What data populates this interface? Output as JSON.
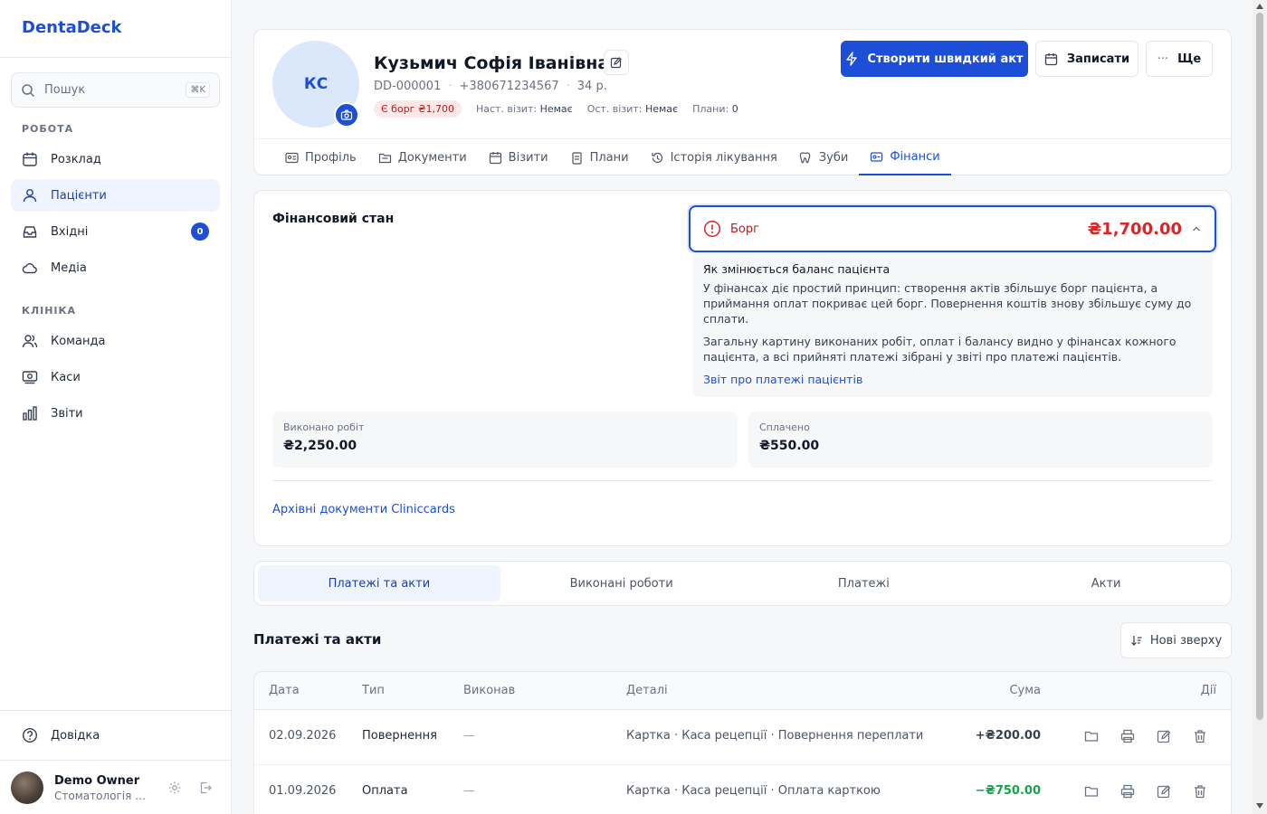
{
  "app": {
    "brand": "DentaDeck"
  },
  "search": {
    "placeholder": "Пошук",
    "shortcut": "⌘K"
  },
  "sidebar": {
    "section_work": "РОБОТА",
    "section_clinic": "КЛІНІКА",
    "items": [
      {
        "label": "Розклад",
        "icon": "calendar-icon"
      },
      {
        "label": "Пацієнти",
        "icon": "users-icon",
        "active": true
      },
      {
        "label": "Вхідні",
        "icon": "inbox-icon",
        "badge": "0"
      },
      {
        "label": "Медіа",
        "icon": "cloud-icon"
      },
      {
        "label": "Команда",
        "icon": "team-icon"
      },
      {
        "label": "Каси",
        "icon": "cash-register-icon"
      },
      {
        "label": "Звіти",
        "icon": "bar-chart-icon"
      }
    ],
    "help": "Довідка",
    "user": {
      "name": "Demo Owner",
      "org": "Стоматологія П..."
    }
  },
  "patient": {
    "initials": "КС",
    "name": "Кузьмич Софія Іванівна",
    "id": "DD-000001",
    "phone": "+380671234567",
    "age": "34 р.",
    "debt_pill": "Є борг ₴1,700",
    "next_visit_label": "Наст. візит:",
    "next_visit_value": "Немає",
    "last_visit_label": "Ост. візит:",
    "last_visit_value": "Немає",
    "plans_label": "Плани:",
    "plans_value": "0"
  },
  "actions": {
    "quick_act": "Створити швидкий акт",
    "book": "Записати",
    "more": "Ще"
  },
  "tabs": [
    {
      "label": "Профіль",
      "icon": "id-card-icon"
    },
    {
      "label": "Документи",
      "icon": "folder-icon"
    },
    {
      "label": "Візити",
      "icon": "calendar-icon"
    },
    {
      "label": "Плани",
      "icon": "clipboard-icon"
    },
    {
      "label": "Історія лікування",
      "icon": "history-icon"
    },
    {
      "label": "Зуби",
      "icon": "tooth-icon"
    },
    {
      "label": "Фінанси",
      "icon": "wallet-icon",
      "active": true
    }
  ],
  "finance": {
    "title": "Фінансовий стан",
    "debt_label": "Борг",
    "debt_amount": "₴1,700.00",
    "info_title": "Як змінюється баланс пацієнта",
    "info_p1": "У фінансах діє простий принцип: створення актів збільшує борг пацієнта, а приймання оплат покриває цей борг. Повернення коштів знову збільшує суму до сплати.",
    "info_p2": "Загальну картину виконаних робіт, оплат і балансу видно у фінансах кожного пацієнта, а всі прийняті платежі зібрані у звіті про платежі пацієнтів.",
    "info_link": "Звіт про платежі пацієнтів",
    "done_label": "Виконано робіт",
    "done_value": "₴2,250.00",
    "paid_label": "Сплачено",
    "paid_value": "₴550.00",
    "archive_link": "Архівні документи Cliniccards"
  },
  "segments": [
    "Платежі та акти",
    "Виконані роботи",
    "Платежі",
    "Акти"
  ],
  "list": {
    "title": "Платежі та акти",
    "sort_label": "Нові зверху",
    "columns": {
      "date": "Дата",
      "type": "Тип",
      "executor": "Виконав",
      "details": "Деталі",
      "amount": "Сума",
      "actions": "Дії"
    },
    "rows": [
      {
        "date": "02.09.2026",
        "type": "Повернення",
        "executor": "—",
        "details": "Картка · Каса рецепції · Повернення переплати",
        "amount": "+₴200.00"
      },
      {
        "date": "01.09.2026",
        "type": "Оплата",
        "executor": "—",
        "details": "Картка · Каса рецепції · Оплата карткою",
        "amount": "−₴750.00"
      }
    ]
  },
  "colors": {
    "accent": "#1d4ed8",
    "danger": "#dc2626",
    "success": "#16a34a"
  }
}
